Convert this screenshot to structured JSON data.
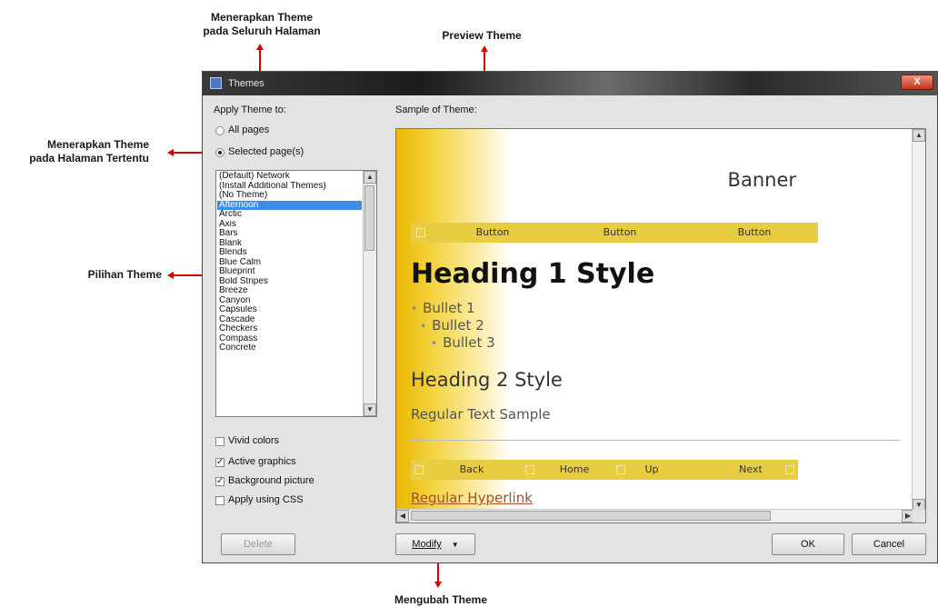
{
  "annotations": {
    "apply_all_pages": [
      "Menerapkan Theme",
      "pada Seluruh Halaman"
    ],
    "preview_theme": "Preview Theme",
    "apply_selected_pages": [
      "Menerapkan Theme",
      "pada Halaman Tertentu"
    ],
    "theme_options": "Pilihan Theme",
    "modify_theme": "Mengubah Theme"
  },
  "window": {
    "title": "Themes",
    "close_label": "X"
  },
  "apply": {
    "label": "Apply Theme to:",
    "all_pages": "All pages",
    "selected_pages": "Selected page(s)",
    "selected": "selected_pages"
  },
  "theme_list": {
    "items": [
      "(Default) Network",
      "(Install Additional Themes)",
      "(No Theme)",
      "Afternoon",
      "Arctic",
      "Axis",
      "Bars",
      "Blank",
      "Blends",
      "Blue Calm",
      "Blueprint",
      "Bold Stripes",
      "Breeze",
      "Canyon",
      "Capsules",
      "Cascade",
      "Checkers",
      "Compass",
      "Concrete"
    ],
    "selected": "Afternoon"
  },
  "options": {
    "vivid_colors": {
      "label": "Vivid colors",
      "checked": false
    },
    "active_graphics": {
      "label": "Active graphics",
      "checked": true
    },
    "background_picture": {
      "label": "Background picture",
      "checked": true
    },
    "apply_css": {
      "label": "Apply using CSS",
      "checked": false
    }
  },
  "sample": {
    "label": "Sample of Theme:",
    "banner": "Banner",
    "nav_buttons": [
      "Button",
      "Button",
      "Button"
    ],
    "heading1": "Heading 1 Style",
    "bullets": [
      "Bullet 1",
      "Bullet 2",
      "Bullet 3"
    ],
    "heading2": "Heading 2 Style",
    "regular_text": "Regular Text Sample",
    "bottom_nav": [
      "Back",
      "Home",
      "Up",
      "Next"
    ],
    "hyperlink": "Regular Hyperlink"
  },
  "buttons": {
    "delete": "Delete",
    "modify": "Modify",
    "modify_arrow": "▼",
    "ok": "OK",
    "cancel": "Cancel"
  },
  "colors": {
    "annotation_red": "#d40000",
    "theme_yellow": "#e8cc42",
    "selection_blue": "#3b8ee8"
  }
}
